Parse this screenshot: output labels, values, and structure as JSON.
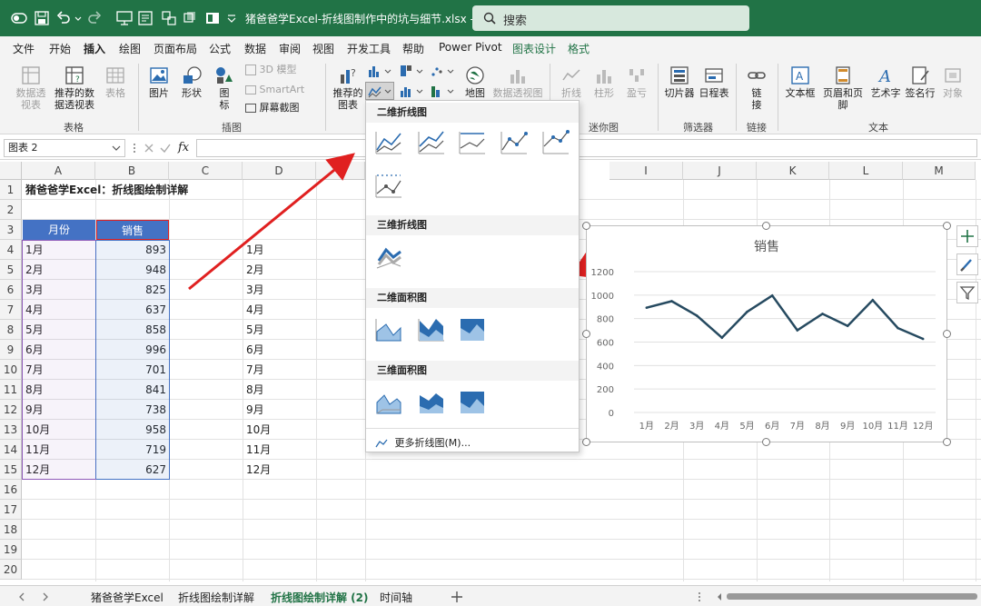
{
  "titlebar": {
    "doc_title": "猪爸爸学Excel-折线图制作中的坑与细节.xlsx  -  Ex...",
    "search_label": "搜索"
  },
  "menu": [
    "文件",
    "开始",
    "插入",
    "绘图",
    "页面布局",
    "公式",
    "数据",
    "审阅",
    "视图",
    "开发工具",
    "帮助",
    "Power Pivot",
    "图表设计",
    "格式"
  ],
  "ribbon": {
    "pivot_table": "数据透视表",
    "recommended_pivot": "推荐的数据透视表",
    "table": "表格",
    "group_tables": "表格",
    "picture": "图片",
    "shapes": "形状",
    "icons": "图标",
    "model3d": "3D 模型",
    "smartart": "SmartArt",
    "screenshot": "屏幕截图",
    "group_illustrations": "插图",
    "recommended_charts": "推荐的图表",
    "maps": "地图",
    "pivot_chart": "数据透视图",
    "spark_line": "折线",
    "spark_column": "柱形",
    "spark_winloss": "盈亏",
    "group_sparklines": "迷你图",
    "slicer": "切片器",
    "timeline": "日程表",
    "group_filters": "筛选器",
    "link": "链接",
    "group_links": "链接",
    "textbox": "文本框",
    "header_footer": "页眉和页脚",
    "wordart": "艺术字",
    "signature": "签名行",
    "object": "对象",
    "group_text": "文本"
  },
  "formula_bar": {
    "name_box": "图表 2",
    "fx": "fx"
  },
  "columns": [
    "A",
    "B",
    "C",
    "D",
    "E",
    "I",
    "J",
    "K",
    "L",
    "M"
  ],
  "rows": [
    "1",
    "2",
    "3",
    "4",
    "5",
    "6",
    "7",
    "8",
    "9",
    "10",
    "11",
    "12",
    "13",
    "14",
    "15",
    "16",
    "17",
    "18",
    "19",
    "20"
  ],
  "sheet": {
    "title": "猪爸爸学Excel：折线图绘制详解",
    "header_month": "月份",
    "header_sales": "销售",
    "months": [
      "1月",
      "2月",
      "3月",
      "4月",
      "5月",
      "6月",
      "7月",
      "8月",
      "9月",
      "10月",
      "11月",
      "12月"
    ],
    "sales": [
      893,
      948,
      825,
      637,
      858,
      996,
      701,
      841,
      738,
      958,
      719,
      627
    ],
    "d_months": [
      "1月",
      "2月",
      "3月",
      "4月",
      "5月",
      "6月",
      "7月",
      "8月",
      "9月",
      "10月",
      "11月",
      "12月"
    ]
  },
  "dropdown": {
    "sec_2d_line": "二维折线图",
    "sec_3d_line": "三维折线图",
    "sec_2d_area": "二维面积图",
    "sec_3d_area": "三维面积图",
    "more": "更多折线图(M)..."
  },
  "sheet_tabs": [
    "猪爸爸学Excel",
    "折线图绘制详解",
    "折线图绘制详解 (2)",
    "时间轴"
  ],
  "colors": {
    "excel_green": "#217346",
    "header_fill": "#4472c4",
    "series_line": "#264a60",
    "arrow_red": "#e02020"
  },
  "chart_data": {
    "type": "line",
    "title": "销售",
    "categories": [
      "1月",
      "2月",
      "3月",
      "4月",
      "5月",
      "6月",
      "7月",
      "8月",
      "9月",
      "10月",
      "11月",
      "12月"
    ],
    "values": [
      893,
      948,
      825,
      637,
      858,
      996,
      701,
      841,
      738,
      958,
      719,
      627
    ],
    "yticks": [
      "0",
      "200",
      "400",
      "600",
      "800",
      "1000",
      "1200"
    ],
    "ylim": [
      0,
      1200
    ],
    "grid": true
  }
}
